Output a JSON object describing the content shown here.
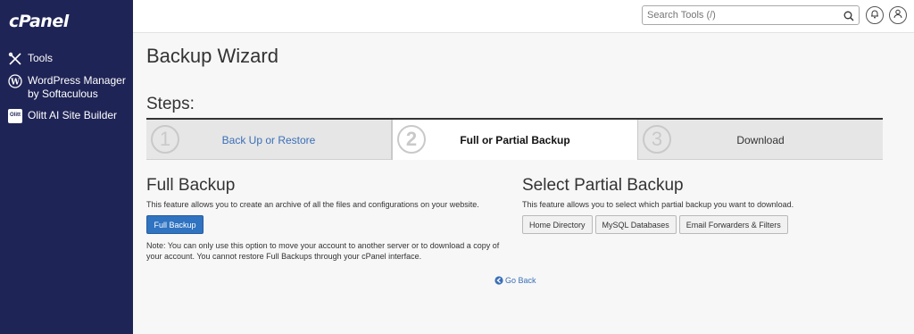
{
  "sidebar": {
    "logo": "cPanel",
    "items": [
      {
        "label": "Tools",
        "icon": "tools-icon"
      },
      {
        "label": "WordPress Manager by Softaculous",
        "icon": "wordpress-icon"
      },
      {
        "label": "Olitt AI Site Builder",
        "icon": "olitt-icon",
        "badge": "Olitt"
      }
    ]
  },
  "header": {
    "search_placeholder": "Search Tools (/)",
    "icons": [
      "search-icon",
      "bell-icon",
      "user-icon"
    ]
  },
  "page": {
    "title": "Backup Wizard",
    "steps_title": "Steps:",
    "steps": [
      {
        "num": "1",
        "label": "Back Up or Restore",
        "state": "link"
      },
      {
        "num": "2",
        "label": "Full or Partial Backup",
        "state": "active"
      },
      {
        "num": "3",
        "label": "Download",
        "state": "inactive"
      }
    ]
  },
  "full_backup": {
    "title": "Full Backup",
    "description": "This feature allows you to create an archive of all the files and configurations on your website.",
    "button": "Full Backup",
    "note": "Note: You can only use this option to move your account to another server or to download a copy of your account. You cannot restore Full Backups through your cPanel interface."
  },
  "partial_backup": {
    "title": "Select Partial Backup",
    "description": "This feature allows you to select which partial backup you want to download.",
    "buttons": [
      "Home Directory",
      "MySQL Databases",
      "Email Forwarders & Filters"
    ]
  },
  "footer": {
    "go_back": "Go Back"
  },
  "colors": {
    "sidebar_bg": "#1f2456",
    "primary": "#2f73c1",
    "link": "#3a6fb7"
  }
}
